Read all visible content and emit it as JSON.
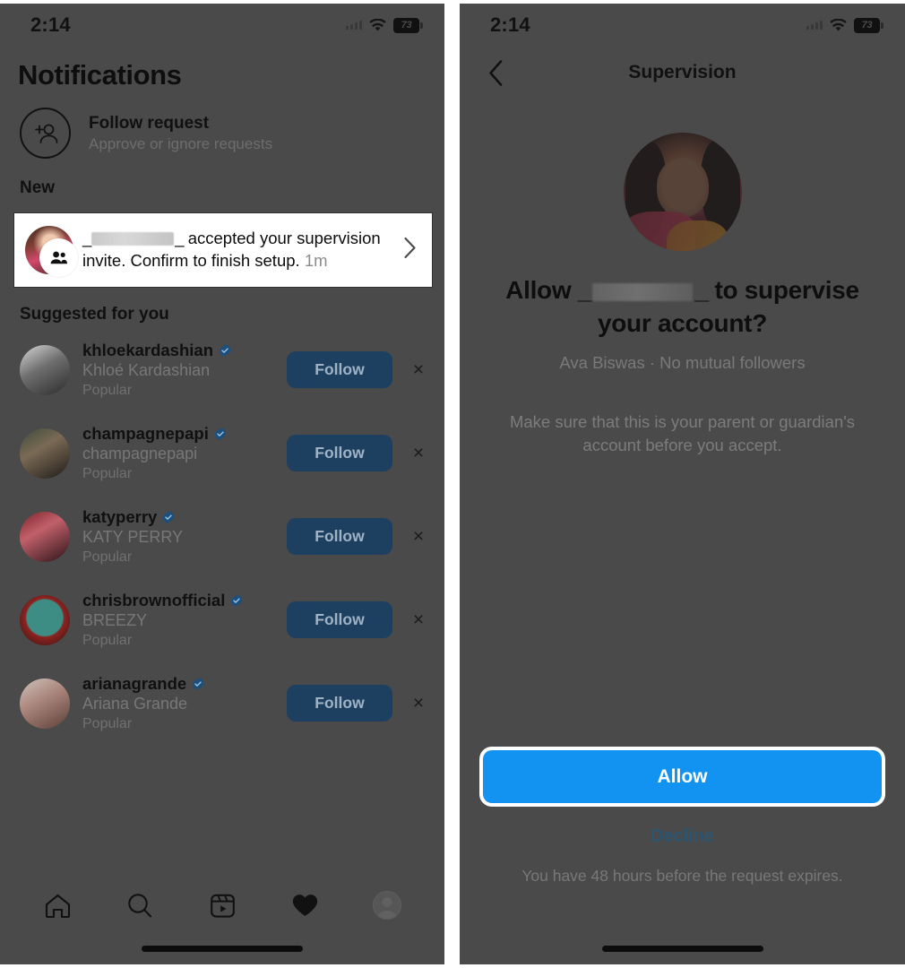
{
  "status_bar": {
    "time": "2:14",
    "battery_level": "73",
    "wifi_icon": "wifi-icon",
    "signal_icon": "cellular-signal-icon"
  },
  "left_screen": {
    "title": "Notifications",
    "follow_request": {
      "icon": "add-person-icon",
      "title": "Follow request",
      "subtitle": "Approve or ignore requests"
    },
    "sections": {
      "new": "New",
      "suggested": "Suggested for you"
    },
    "notification": {
      "redacted_name": "__________",
      "text_before": "",
      "text_after": " accepted your supervision invite. Confirm to finish setup.",
      "time": "1m",
      "badge_icon": "people-icon",
      "chevron_icon": "chevron-right-icon",
      "highlighted": true
    },
    "suggestions": [
      {
        "username": "khloekardashian",
        "verified": true,
        "name": "Khloé Kardashian",
        "reason": "Popular",
        "action": "Follow",
        "dismiss": "×"
      },
      {
        "username": "champagnepapi",
        "verified": true,
        "name": "champagnepapi",
        "reason": "Popular",
        "action": "Follow",
        "dismiss": "×"
      },
      {
        "username": "katyperry",
        "verified": true,
        "name": "KATY PERRY",
        "reason": "Popular",
        "action": "Follow",
        "dismiss": "×"
      },
      {
        "username": "chrisbrownofficial",
        "verified": true,
        "name": "BREEZY",
        "reason": "Popular",
        "action": "Follow",
        "dismiss": "×"
      },
      {
        "username": "arianagrande",
        "verified": true,
        "name": "Ariana Grande",
        "reason": "Popular",
        "action": "Follow",
        "dismiss": "×"
      }
    ],
    "tab_bar": [
      {
        "icon": "home-icon",
        "label": "Home",
        "active": false
      },
      {
        "icon": "search-icon",
        "label": "Search",
        "active": false
      },
      {
        "icon": "reels-icon",
        "label": "Reels",
        "active": false
      },
      {
        "icon": "heart-icon",
        "label": "Activity",
        "active": true
      },
      {
        "icon": "profile-avatar-icon",
        "label": "Profile",
        "active": false
      }
    ]
  },
  "right_screen": {
    "nav": {
      "back_icon": "chevron-left-icon",
      "title": "Supervision"
    },
    "avatar": "supervisor-profile-photo",
    "heading_prefix": "Allow ",
    "heading_redacted": "__________",
    "heading_suffix": " to supervise your account?",
    "meta": "Ava Biswas · No mutual followers",
    "note": "Make sure that this is your parent or guardian's account before you accept.",
    "allow_label": "Allow",
    "decline_label": "Decline",
    "expire_note": "You have 48 hours before the request expires."
  },
  "colors": {
    "dim_overlay_bg": "#4a4a4a",
    "allow_blue": "#1393f1",
    "follow_blue_dimmed": "#1d3f60",
    "decline_blue_dimmed": "#2b5571",
    "highlight_white": "#ffffff"
  }
}
